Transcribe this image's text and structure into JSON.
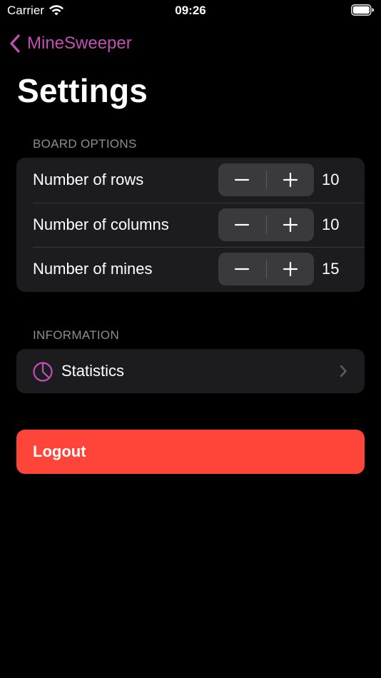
{
  "status_bar": {
    "carrier": "Carrier",
    "time": "09:26"
  },
  "nav": {
    "back_label": "MineSweeper",
    "title": "Settings"
  },
  "board_options": {
    "header": "BOARD OPTIONS",
    "rows": [
      {
        "label": "Number of rows",
        "value": "10"
      },
      {
        "label": "Number of columns",
        "value": "10"
      },
      {
        "label": "Number of mines",
        "value": "15"
      }
    ]
  },
  "information": {
    "header": "INFORMATION",
    "statistics_label": "Statistics"
  },
  "logout_label": "Logout",
  "colors": {
    "accent": "#c250b4",
    "destructive": "#ff453a",
    "cell": "#1c1c1e",
    "stepper": "#3a3a3c",
    "secondary_text": "#8d8d93"
  },
  "icons": {
    "stepper_minus": "minus-icon",
    "stepper_plus": "plus-icon",
    "statistics": "pie-chart-icon",
    "disclosure": "chevron-right-icon",
    "back": "chevron-left-icon"
  }
}
